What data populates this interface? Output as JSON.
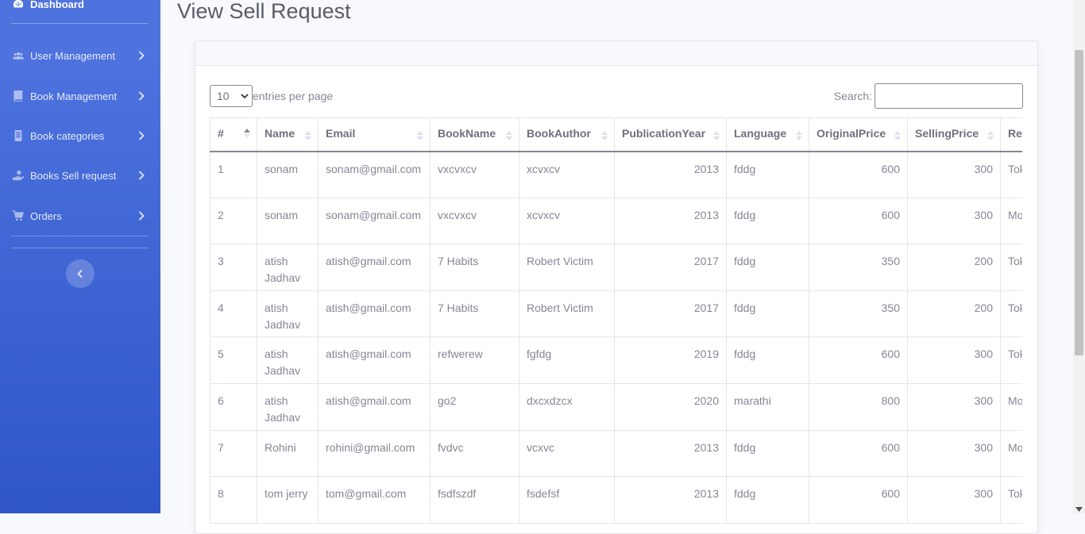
{
  "sidebar": {
    "brand": "Dashboard",
    "items": [
      {
        "label": "User Management",
        "icon": "users-icon"
      },
      {
        "label": "Book Management",
        "icon": "book-icon"
      },
      {
        "label": "Book categories",
        "icon": "book-open-icon"
      },
      {
        "label": "Books Sell request",
        "icon": "hand-holding-icon"
      },
      {
        "label": "Orders",
        "icon": "shopping-cart-icon"
      }
    ]
  },
  "page": {
    "title": "View Sell Request"
  },
  "controls": {
    "entries_value": "10",
    "entries_label": "entries per page",
    "search_label": "Search:",
    "search_value": ""
  },
  "table": {
    "columns": [
      "#",
      "Name",
      "Email",
      "BookName",
      "BookAuthor",
      "PublicationYear",
      "Language",
      "OriginalPrice",
      "SellingPrice",
      "Re"
    ],
    "rows": [
      [
        "1",
        "sonam",
        "sonam@gmail.com",
        "vxcvxcv",
        "xcvxcv",
        "2013",
        "fddg",
        "600",
        "300",
        "Tok"
      ],
      [
        "2",
        "sonam",
        "sonam@gmail.com",
        "vxcvxcv",
        "xcvxcv",
        "2013",
        "fddg",
        "600",
        "300",
        "Mo"
      ],
      [
        "3",
        "atish Jadhav",
        "atish@gmail.com",
        "7 Habits",
        "Robert Victim",
        "2017",
        "fddg",
        "350",
        "200",
        "Tok"
      ],
      [
        "4",
        "atish Jadhav",
        "atish@gmail.com",
        "7 Habits",
        "Robert Victim",
        "2017",
        "fddg",
        "350",
        "200",
        "Tok"
      ],
      [
        "5",
        "atish Jadhav",
        "atish@gmail.com",
        "refwerew",
        "fgfdg",
        "2019",
        "fddg",
        "600",
        "300",
        "Tok"
      ],
      [
        "6",
        "atish Jadhav",
        "atish@gmail.com",
        "go2",
        "dxcxdzcx",
        "2020",
        "marathi",
        "800",
        "300",
        "Mo"
      ],
      [
        "7",
        "Rohini",
        "rohini@gmail.com",
        "fvdvc",
        "vcxvc",
        "2013",
        "fddg",
        "600",
        "300",
        "Mo"
      ],
      [
        "8",
        "tom jerry",
        "tom@gmail.com",
        "fsdfszdf",
        "fsdefsf",
        "2013",
        "fddg",
        "600",
        "300",
        "Tok"
      ]
    ]
  },
  "colors": {
    "sidebar_top": "#4e73df",
    "sidebar_bottom": "#2f56c8",
    "text_muted": "#858796"
  }
}
